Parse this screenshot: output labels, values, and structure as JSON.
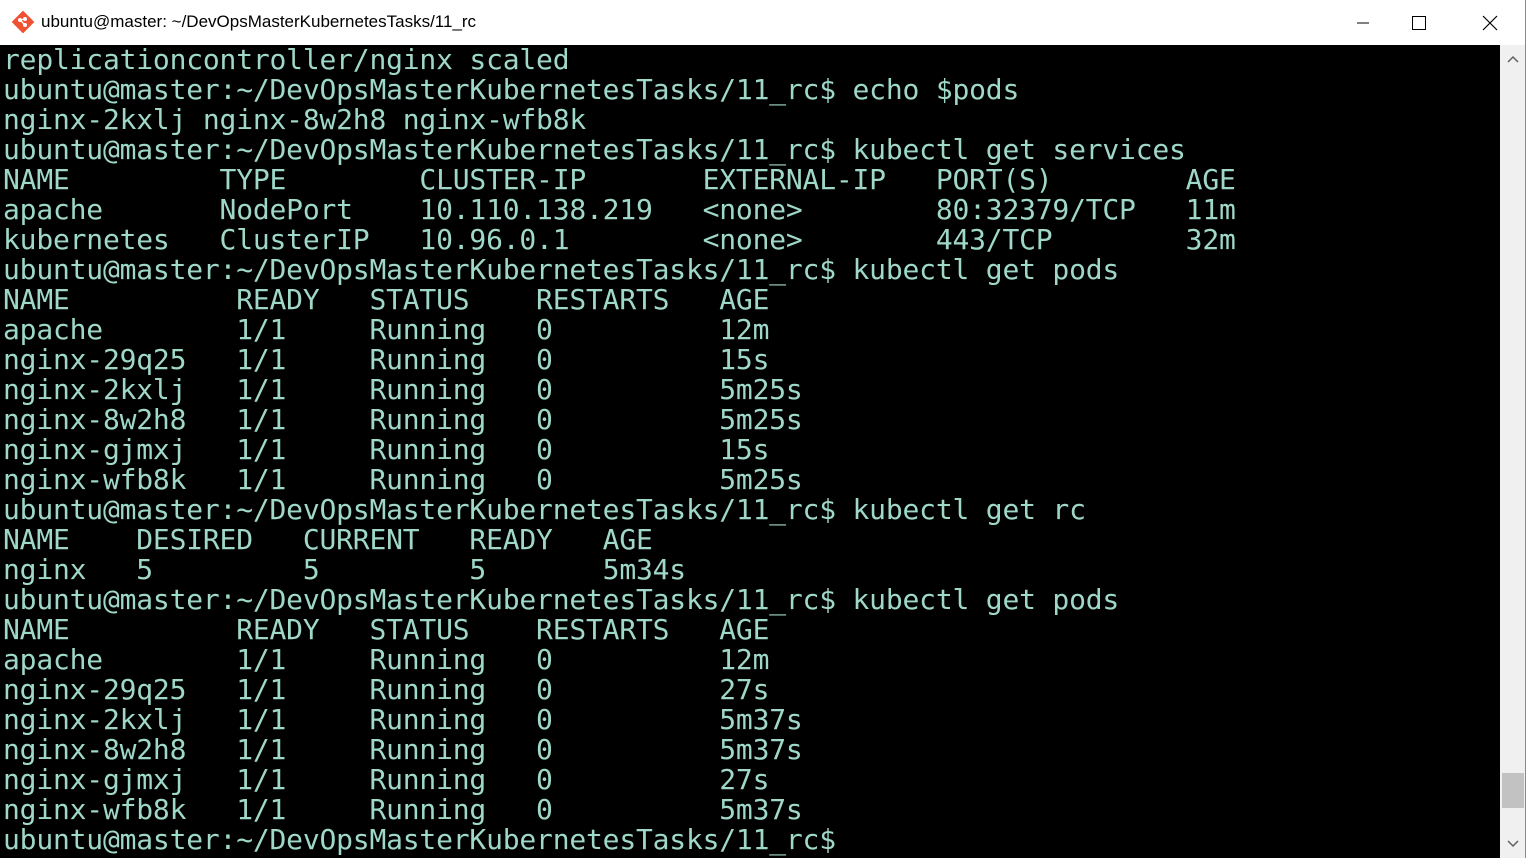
{
  "window": {
    "title": "ubuntu@master: ~/DevOpsMasterKubernetesTasks/11_rc",
    "app_icon": "git-bash-diamond-icon",
    "controls": {
      "minimize": "minimize-icon",
      "maximize": "maximize-icon",
      "close": "close-icon"
    }
  },
  "colors": {
    "terminal_background": "#000000",
    "terminal_text": "#9fd8c9",
    "titlebar": "#ffffff"
  },
  "terminal": {
    "lines": [
      "replicationcontroller/nginx scaled",
      "ubuntu@master:~/DevOpsMasterKubernetesTasks/11_rc$ echo $pods",
      "nginx-2kxlj nginx-8w2h8 nginx-wfb8k",
      "ubuntu@master:~/DevOpsMasterKubernetesTasks/11_rc$ kubectl get services",
      "NAME         TYPE        CLUSTER-IP       EXTERNAL-IP   PORT(S)        AGE",
      "apache       NodePort    10.110.138.219   <none>        80:32379/TCP   11m",
      "kubernetes   ClusterIP   10.96.0.1        <none>        443/TCP        32m",
      "ubuntu@master:~/DevOpsMasterKubernetesTasks/11_rc$ kubectl get pods",
      "NAME          READY   STATUS    RESTARTS   AGE",
      "apache        1/1     Running   0          12m",
      "nginx-29q25   1/1     Running   0          15s",
      "nginx-2kxlj   1/1     Running   0          5m25s",
      "nginx-8w2h8   1/1     Running   0          5m25s",
      "nginx-gjmxj   1/1     Running   0          15s",
      "nginx-wfb8k   1/1     Running   0          5m25s",
      "ubuntu@master:~/DevOpsMasterKubernetesTasks/11_rc$ kubectl get rc",
      "NAME    DESIRED   CURRENT   READY   AGE",
      "nginx   5         5         5       5m34s",
      "ubuntu@master:~/DevOpsMasterKubernetesTasks/11_rc$ kubectl get pods",
      "NAME          READY   STATUS    RESTARTS   AGE",
      "apache        1/1     Running   0          12m",
      "nginx-29q25   1/1     Running   0          27s",
      "nginx-2kxlj   1/1     Running   0          5m37s",
      "nginx-8w2h8   1/1     Running   0          5m37s",
      "nginx-gjmxj   1/1     Running   0          27s",
      "nginx-wfb8k   1/1     Running   0          5m37s",
      "ubuntu@master:~/DevOpsMasterKubernetesTasks/11_rc$"
    ]
  },
  "scrollbar": {
    "up": "scroll-up-arrow-icon",
    "down": "scroll-down-arrow-icon",
    "position": 0.97
  }
}
